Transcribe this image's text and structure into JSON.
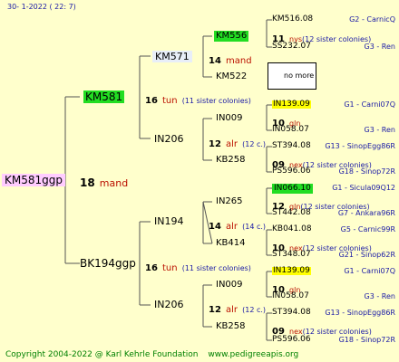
{
  "header": {
    "date": "30-   1-2022  (  22:   7)"
  },
  "root": {
    "name": "KM581ggp",
    "num": "18",
    "owner": "mand"
  },
  "gen1": [
    {
      "name": "KM581",
      "num": "16",
      "owner": "tun",
      "sister": "(11 sister colonies)"
    },
    {
      "name": "BK194ggp",
      "num": "16",
      "owner": "tun",
      "sister": "(11 sister colonies)"
    }
  ],
  "gen2": [
    {
      "name": "KM571",
      "num": "14",
      "owner": "mand",
      "sister": ""
    },
    {
      "name": "IN206",
      "num": "12",
      "owner": "alr",
      "sister": "(12 c.)"
    },
    {
      "name": "IN194",
      "num": "14",
      "owner": "alr",
      "sister": "(14 c.)"
    },
    {
      "name": "IN206",
      "num": "12",
      "owner": "alr",
      "sister": "(12 c.)"
    }
  ],
  "gen3": [
    {
      "name": "KM556",
      "num": "11",
      "owner": "nys",
      "sister": "(12 sister colonies)"
    },
    {
      "name": "KM522",
      "num": "",
      "owner": "",
      "sister": "",
      "nomore": "no more"
    },
    {
      "name": "IN009",
      "num": "10",
      "owner": "gln",
      "sister": ""
    },
    {
      "name": "KB258",
      "num": "09",
      "owner": "nex",
      "sister": "(12 sister colonies)"
    },
    {
      "name": "IN265",
      "num": "12",
      "owner": "gln",
      "sister": "(12 sister colonies)"
    },
    {
      "name": "KB414",
      "num": "10",
      "owner": "nex",
      "sister": "(12 sister colonies)"
    },
    {
      "name": "IN009",
      "num": "10",
      "owner": "gln",
      "sister": ""
    },
    {
      "name": "KB258",
      "num": "09",
      "owner": "nex",
      "sister": "(12 sister colonies)"
    }
  ],
  "gen4": [
    {
      "name": "KM516.08",
      "code": "G2 - CarnicQ"
    },
    {
      "name": "SS232.07",
      "code": "G3 - Ren"
    },
    {
      "name": "IN139.09",
      "code": "G1 - Carni07Q"
    },
    {
      "name": "IN058.07",
      "code": "G3 - Ren"
    },
    {
      "name": "ST394.08",
      "code": "G13 - SinopEgg86R"
    },
    {
      "name": "PS596.06",
      "code": "G18 - Sinop72R"
    },
    {
      "name": "IN066.10",
      "code": "G1 - Sicula09Q12"
    },
    {
      "name": "ST442.08",
      "code": "G7 - Ankara96R"
    },
    {
      "name": "KB041.08",
      "code": "G5 - Carnic99R"
    },
    {
      "name": "ST348.07",
      "code": "G21 - Sinop62R"
    },
    {
      "name": "IN139.09",
      "code": "G1 - Carni07Q"
    },
    {
      "name": "IN058.07",
      "code": "G3 - Ren"
    },
    {
      "name": "ST394.08",
      "code": "G13 - SinopEgg86R"
    },
    {
      "name": "PS596.06",
      "code": "G18 - Sinop72R"
    }
  ],
  "footer": {
    "copyright": "Copyright 2004-2022 @ Karl Kehrle Foundation",
    "site": "www.pedigreeapis.org"
  },
  "colors": {
    "background": "#ffffcc",
    "highlight_green": "#22dd22",
    "highlight_yellow": "#ffff00",
    "highlight_pink": "#ffccff",
    "blue_text": "#1a1aa6",
    "red_text": "#bb1100",
    "footer": "#008000"
  }
}
